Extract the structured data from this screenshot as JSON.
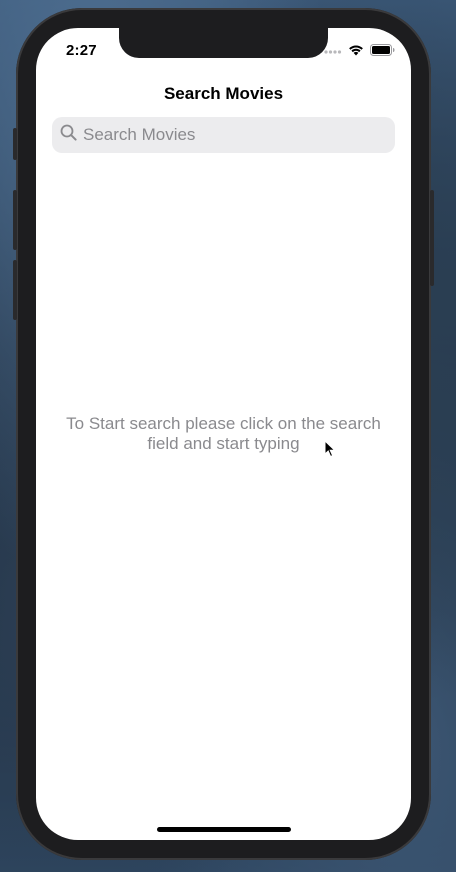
{
  "status_bar": {
    "time": "2:27",
    "icons": [
      "cellular-signal-icon",
      "wifi-icon",
      "battery-icon"
    ]
  },
  "navigation": {
    "title": "Search Movies"
  },
  "search": {
    "placeholder": "Search Movies",
    "value": "",
    "icon": "search-icon"
  },
  "empty_state": {
    "message": "To Start search please click on the search field and start typing"
  },
  "colors": {
    "screen_background": "#ffffff",
    "search_field_background": "#ececee",
    "secondary_text": "#8a8a8e",
    "device_frame": "#1d1d1f"
  }
}
